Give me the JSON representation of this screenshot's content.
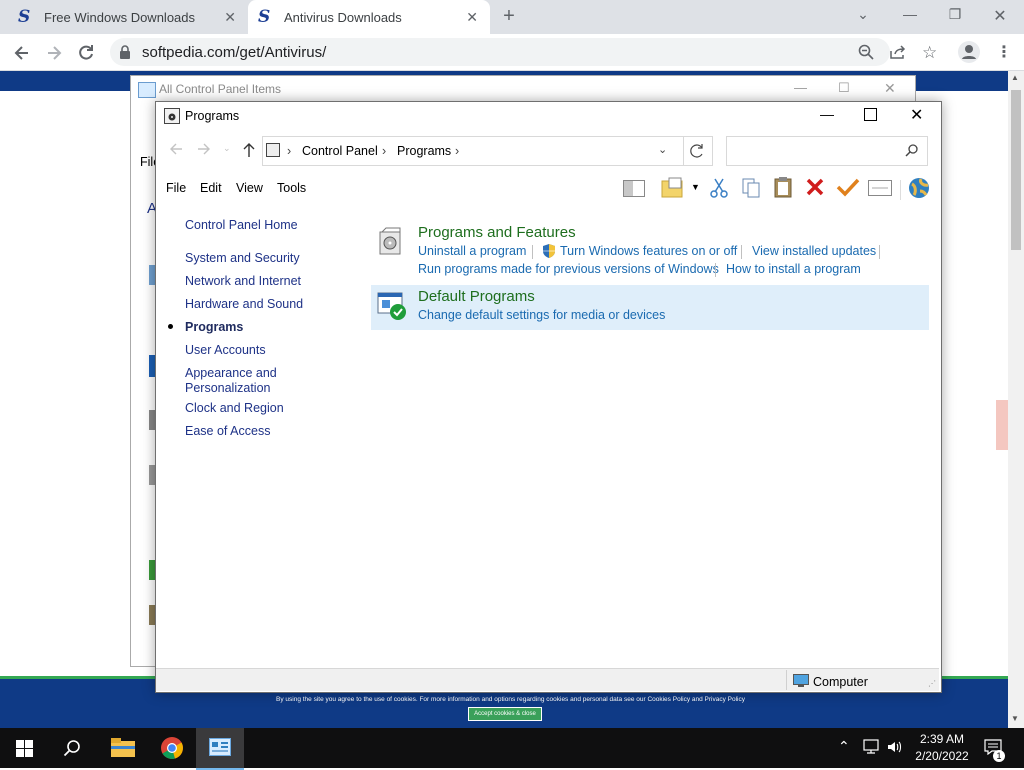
{
  "browser": {
    "tabs": [
      {
        "title": "Free Windows Downloads",
        "favicon": "S"
      },
      {
        "title": "Antivirus Downloads",
        "favicon": "S"
      }
    ],
    "url": "softpedia.com/get/Antivirus/",
    "new_tab": "+"
  },
  "site": {
    "cookie_text": "By using the site you agree to the use of cookies. For more information and options regarding cookies and personal data see our Cookies Policy and Privacy Policy",
    "cookie_button": "Accept cookies & close"
  },
  "bg_window": {
    "title": "All Control Panel Items",
    "menu_fragment": "File",
    "link_fragment": "A"
  },
  "window": {
    "title": "Programs",
    "breadcrumb": [
      "Control Panel",
      "Programs"
    ],
    "menu": [
      "File",
      "Edit",
      "View",
      "Tools"
    ],
    "left_nav": [
      {
        "label": "Control Panel Home",
        "current": false
      },
      {
        "label": "System and Security",
        "current": false
      },
      {
        "label": "Network and Internet",
        "current": false
      },
      {
        "label": "Hardware and Sound",
        "current": false
      },
      {
        "label": "Programs",
        "current": true
      },
      {
        "label": "User Accounts",
        "current": false
      },
      {
        "label": "Appearance and",
        "current": false
      },
      {
        "label": "Personalization",
        "current": false
      },
      {
        "label": "Clock and Region",
        "current": false
      },
      {
        "label": "Ease of Access",
        "current": false
      }
    ],
    "categories": [
      {
        "title": "Programs and Features",
        "links": [
          "Uninstall a program",
          "Turn Windows features on or off",
          "View installed updates",
          "Run programs made for previous versions of Windows",
          "How to install a program"
        ]
      },
      {
        "title": "Default Programs",
        "links": [
          "Change default settings for media or devices"
        ]
      }
    ],
    "status": "Computer"
  },
  "taskbar": {
    "time": "2:39 AM",
    "date": "2/20/2022",
    "notification_count": "1"
  }
}
